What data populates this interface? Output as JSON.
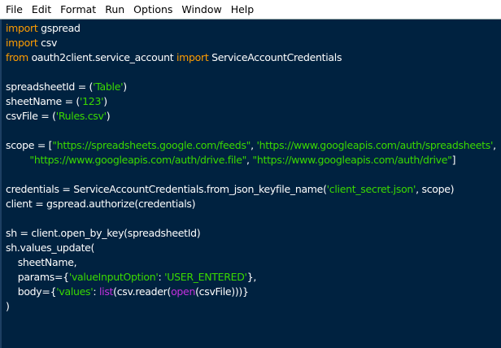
{
  "menu": [
    "File",
    "Edit",
    "Format",
    "Run",
    "Options",
    "Window",
    "Help"
  ],
  "colors": {
    "background": "#002240",
    "keyword": "#ff9d00",
    "string": "#3ad900",
    "builtin": "#c630e0",
    "text": "#ffffff"
  },
  "code_lines": [
    [
      [
        "kw",
        "import"
      ],
      [
        "plain",
        " gspread"
      ]
    ],
    [
      [
        "kw",
        "import"
      ],
      [
        "plain",
        " csv"
      ]
    ],
    [
      [
        "kw",
        "from"
      ],
      [
        "plain",
        " oauth2client.service_account "
      ],
      [
        "kw",
        "import"
      ],
      [
        "plain",
        " ServiceAccountCredentials"
      ]
    ],
    [],
    [
      [
        "plain",
        "spreadsheetId = ("
      ],
      [
        "str",
        "'Table'"
      ],
      [
        "plain",
        ")"
      ]
    ],
    [
      [
        "plain",
        "sheetName = ("
      ],
      [
        "str",
        "'123'"
      ],
      [
        "plain",
        ")"
      ]
    ],
    [
      [
        "plain",
        "csvFile = ("
      ],
      [
        "str",
        "'Rules.csv'"
      ],
      [
        "plain",
        ")"
      ]
    ],
    [],
    [
      [
        "plain",
        "scope = ["
      ],
      [
        "str",
        "\"https://spreadsheets.google.com/feeds\""
      ],
      [
        "plain",
        ", "
      ],
      [
        "str",
        "'https://www.googleapis.com/auth/spreadsheets'"
      ],
      [
        "plain",
        ","
      ]
    ],
    [
      [
        "plain",
        "        "
      ],
      [
        "str",
        "\"https://www.googleapis.com/auth/drive.file\""
      ],
      [
        "plain",
        ", "
      ],
      [
        "str",
        "\"https://www.googleapis.com/auth/drive\""
      ],
      [
        "plain",
        "]"
      ]
    ],
    [],
    [
      [
        "plain",
        "credentials = ServiceAccountCredentials.from_json_keyfile_name("
      ],
      [
        "str",
        "'client_secret.json'"
      ],
      [
        "plain",
        ", scope)"
      ]
    ],
    [
      [
        "plain",
        "client = gspread.authorize(credentials)"
      ]
    ],
    [],
    [
      [
        "plain",
        "sh = client.open_by_key(spreadsheetId)"
      ]
    ],
    [
      [
        "plain",
        "sh.values_update("
      ]
    ],
    [
      [
        "plain",
        "    sheetName,"
      ]
    ],
    [
      [
        "plain",
        "    params={"
      ],
      [
        "str",
        "'valueInputOption'"
      ],
      [
        "plain",
        ": "
      ],
      [
        "str",
        "'USER_ENTERED'"
      ],
      [
        "plain",
        "},"
      ]
    ],
    [
      [
        "plain",
        "    body={"
      ],
      [
        "str",
        "'values'"
      ],
      [
        "plain",
        ": "
      ],
      [
        "bi",
        "list"
      ],
      [
        "plain",
        "(csv.reader("
      ],
      [
        "bi",
        "open"
      ],
      [
        "plain",
        "(csvFile)))}"
      ]
    ],
    [
      [
        "plain",
        ")"
      ]
    ]
  ]
}
